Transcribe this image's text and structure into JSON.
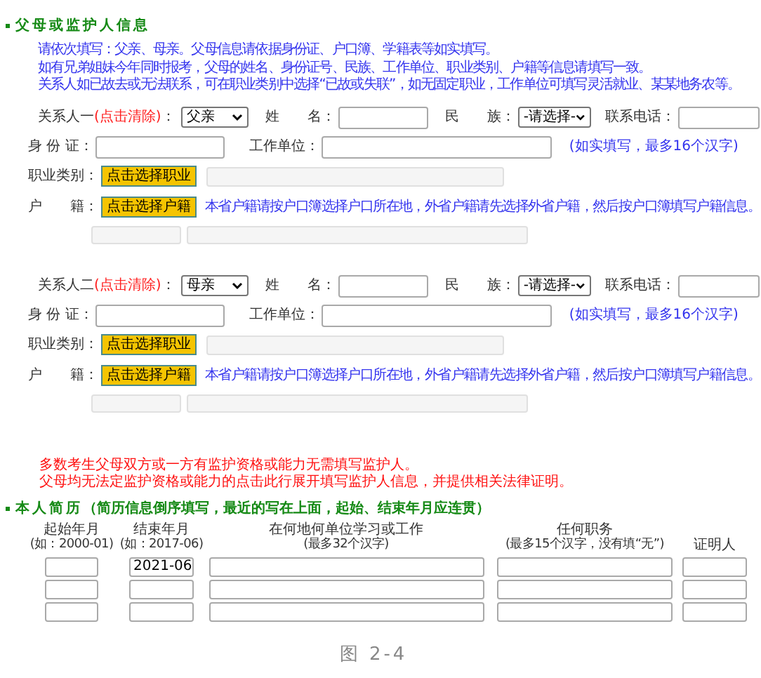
{
  "guardian_section": {
    "title": "父母或监护人信息",
    "notes": [
      "请依次填写：父亲、母亲。父母信息请依据身份证、户口簿、学籍表等如实填写。",
      "如有兄弟姐妹今年同时报考，父母的姓名、身份证号、民族、工作单位、职业类别、户籍等信息请填写一致。",
      "关系人如已故去或无法联系，可在职业类别中选择“已故或失联”，如无固定职业，工作单位可填写灵活就业、某某地务农等。"
    ],
    "contacts": [
      {
        "label": "关系人一",
        "clear_link": "(点击清除)",
        "separator": "：",
        "relation": "父亲",
        "name_label": "姓　　名：",
        "ethnicity_label": "民　　族：",
        "ethnicity": "-请选择-",
        "phone_label": "联系电话：",
        "id_label": "身 份 证：",
        "work_label": "工作单位：",
        "work_hint": "(如实填写，最多16个汉字)",
        "occupation_label": "职业类别：",
        "occupation_button": "点击选择职业",
        "household_label": "户　　籍：",
        "household_button": "点击选择户籍",
        "household_note": "本省户籍请按户口簿选择户口所在地，外省户籍请先选择外省户籍，然后按户口簿填写户籍信息。"
      },
      {
        "label": "关系人二",
        "clear_link": "(点击清除)",
        "separator": "：",
        "relation": "母亲",
        "name_label": "姓　　名：",
        "ethnicity_label": "民　　族：",
        "ethnicity": "-请选择-",
        "phone_label": "联系电话：",
        "id_label": "身 份 证：",
        "work_label": "工作单位：",
        "work_hint": "(如实填写，最多16个汉字)",
        "occupation_label": "职业类别：",
        "occupation_button": "点击选择职业",
        "household_label": "户　　籍：",
        "household_button": "点击选择户籍",
        "household_note": "本省户籍请按户口簿选择户口所在地，外省户籍请先选择外省户籍，然后按户口簿填写户籍信息。"
      }
    ],
    "warnings": [
      "多数考生父母双方或一方有监护资格或能力无需填写监护人。",
      "父母均无法定监护资格或能力的点击此行展开填写监护人信息，并提供相关法律证明。"
    ]
  },
  "resume_section": {
    "title": "本人简历",
    "subtitle": "（简历信息倒序填写，最近的写在上面，起始、结束年月应连贯）",
    "columns": [
      {
        "label": "起始年月",
        "hint": "(如：2000-01)"
      },
      {
        "label": "结束年月",
        "hint": "(如：2017-06)"
      },
      {
        "label": "在何地何单位学习或工作",
        "hint": "(最多32个汉字)"
      },
      {
        "label": "任何职务",
        "hint": "(最多15个汉字，没有填“无”)"
      },
      {
        "label": "证明人"
      }
    ],
    "rows": [
      {
        "end": "2021-06"
      },
      {},
      {}
    ]
  },
  "caption": "图 2-4"
}
